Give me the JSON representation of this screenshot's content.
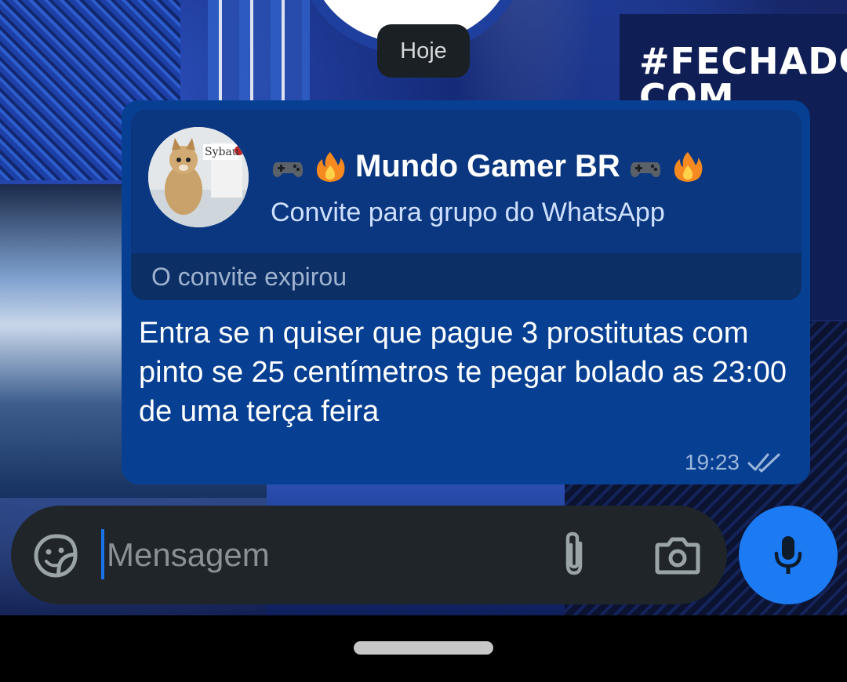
{
  "wallpaper": {
    "banner_text": "#FECHADO COM"
  },
  "date_divider": {
    "label": "Hoje"
  },
  "message": {
    "invite": {
      "group_name": "Mundo Gamer BR",
      "title_emojis": [
        "game-controller-icon",
        "fire-icon"
      ],
      "subtitle": "Convite para grupo do WhatsApp",
      "status": "O convite expirou",
      "avatar_text": "Sybau"
    },
    "text": "Entra se n quiser que pague 3 prostitutas com pinto se 25 centímetros te pegar bolado as 23:00 de uma terça feira",
    "time": "19:23",
    "read_status": "double-check-icon"
  },
  "composer": {
    "placeholder": "Mensagem",
    "value": ""
  },
  "colors": {
    "bubble": "#074092",
    "invite_card": "#0a3780",
    "composer": "#1f2529",
    "mic_button": "#1c7bf2",
    "date_pill": "#1b2024"
  }
}
